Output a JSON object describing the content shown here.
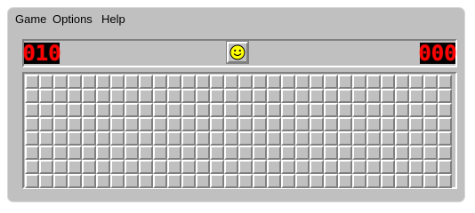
{
  "menu": {
    "items": [
      {
        "label": "Game"
      },
      {
        "label": "Options"
      },
      {
        "label": "Help"
      }
    ]
  },
  "status": {
    "mine_counter": "010",
    "timer": "000",
    "face": "smiley-icon",
    "display_color": "#ff0000"
  },
  "board": {
    "rows": 8,
    "columns": 30,
    "cell_state": "unrevealed"
  }
}
